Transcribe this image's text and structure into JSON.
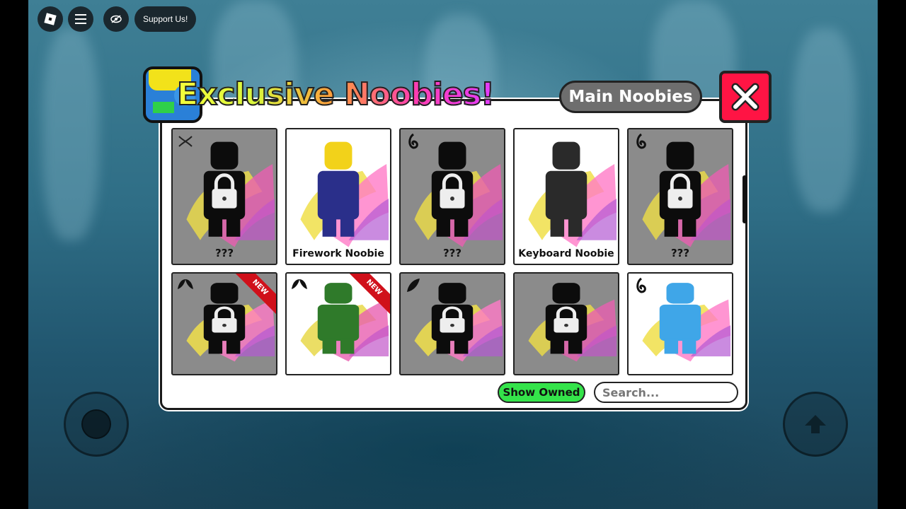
{
  "topbar": {
    "roblox_icon": "roblox-logo-icon",
    "menu_icon": "hamburger-menu-icon",
    "chat_icon": "eye-icon",
    "support_label": "Support Us!"
  },
  "dialog": {
    "title": "Exclusive Noobies!",
    "main_button_label": "Main Noobies",
    "close_icon": "close-x-icon",
    "show_owned_label": "Show Owned",
    "search_placeholder": "Search...",
    "colors": {
      "close_red": "#ff1444",
      "show_owned_green": "#34e34a",
      "locked_card": "#8b8b8b"
    }
  },
  "cards": [
    {
      "name": "???",
      "locked": true,
      "tier_icon": "dna-icon"
    },
    {
      "name": "Firework Noobie",
      "locked": false,
      "tier_icon": ""
    },
    {
      "name": "???",
      "locked": true,
      "tier_icon": "flame-swirl-icon"
    },
    {
      "name": "Keyboard Noobie",
      "locked": false,
      "tier_icon": ""
    },
    {
      "name": "???",
      "locked": true,
      "tier_icon": "flame-swirl-icon"
    },
    {
      "name": "",
      "locked": true,
      "tier_icon": "leaf-icon",
      "badge": "NEW"
    },
    {
      "name": "",
      "locked": false,
      "tier_icon": "leaf-icon",
      "badge": "NEW"
    },
    {
      "name": "",
      "locked": true,
      "tier_icon": "feather-icon"
    },
    {
      "name": "",
      "locked": true,
      "tier_icon": ""
    },
    {
      "name": "",
      "locked": false,
      "tier_icon": "flame-swirl-icon"
    }
  ]
}
